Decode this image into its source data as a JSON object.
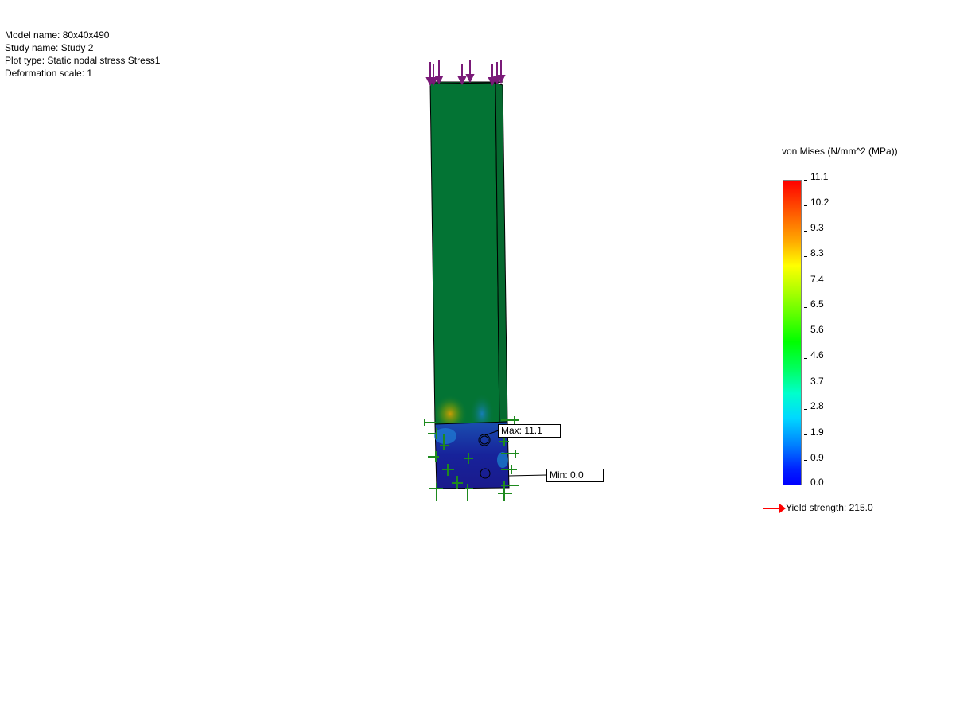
{
  "plot_info": {
    "model_name": "Model name: 80x40x490",
    "study_name": "Study name: Study 2",
    "plot_type": "Plot type: Static nodal stress Stress1",
    "deformation_scale": "Deformation scale: 1"
  },
  "legend": {
    "title": "von Mises (N/mm^2 (MPa))",
    "ticks": [
      "11.1",
      "10.2",
      "9.3",
      "8.3",
      "7.4",
      "6.5",
      "5.6",
      "4.6",
      "3.7",
      "2.8",
      "1.9",
      "0.9",
      "0.0"
    ],
    "yield_label": "Yield strength: 215.0",
    "yield_arrow_color": "#ff0000"
  },
  "callouts": {
    "max_label": "Max: 11.1",
    "min_label": "Min: 0.0"
  },
  "colors": {
    "beam": "#037434",
    "base_plate": "#1a2aa0",
    "load_arrow": "#7a1a78",
    "fixture": "#1e8a1e"
  }
}
